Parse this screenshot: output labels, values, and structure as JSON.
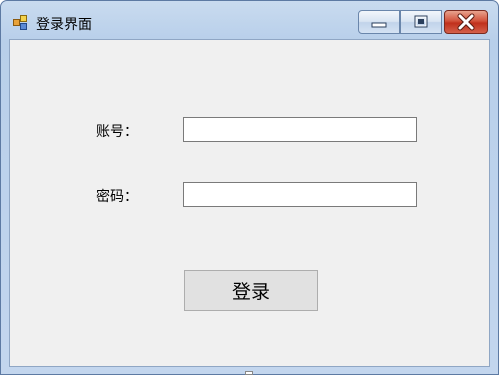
{
  "window": {
    "title": "登录界面",
    "controls": {
      "minimize_icon": "minimize-icon",
      "maximize_icon": "maximize-icon",
      "close_icon": "close-icon"
    }
  },
  "form": {
    "account_label": "账号：",
    "account_value": "",
    "password_label": "密码：",
    "password_value": "",
    "login_button": "登录"
  },
  "colors": {
    "close_button": "#c8402b",
    "client_background": "#f0f0f0",
    "frame": "#bcd1ea"
  }
}
